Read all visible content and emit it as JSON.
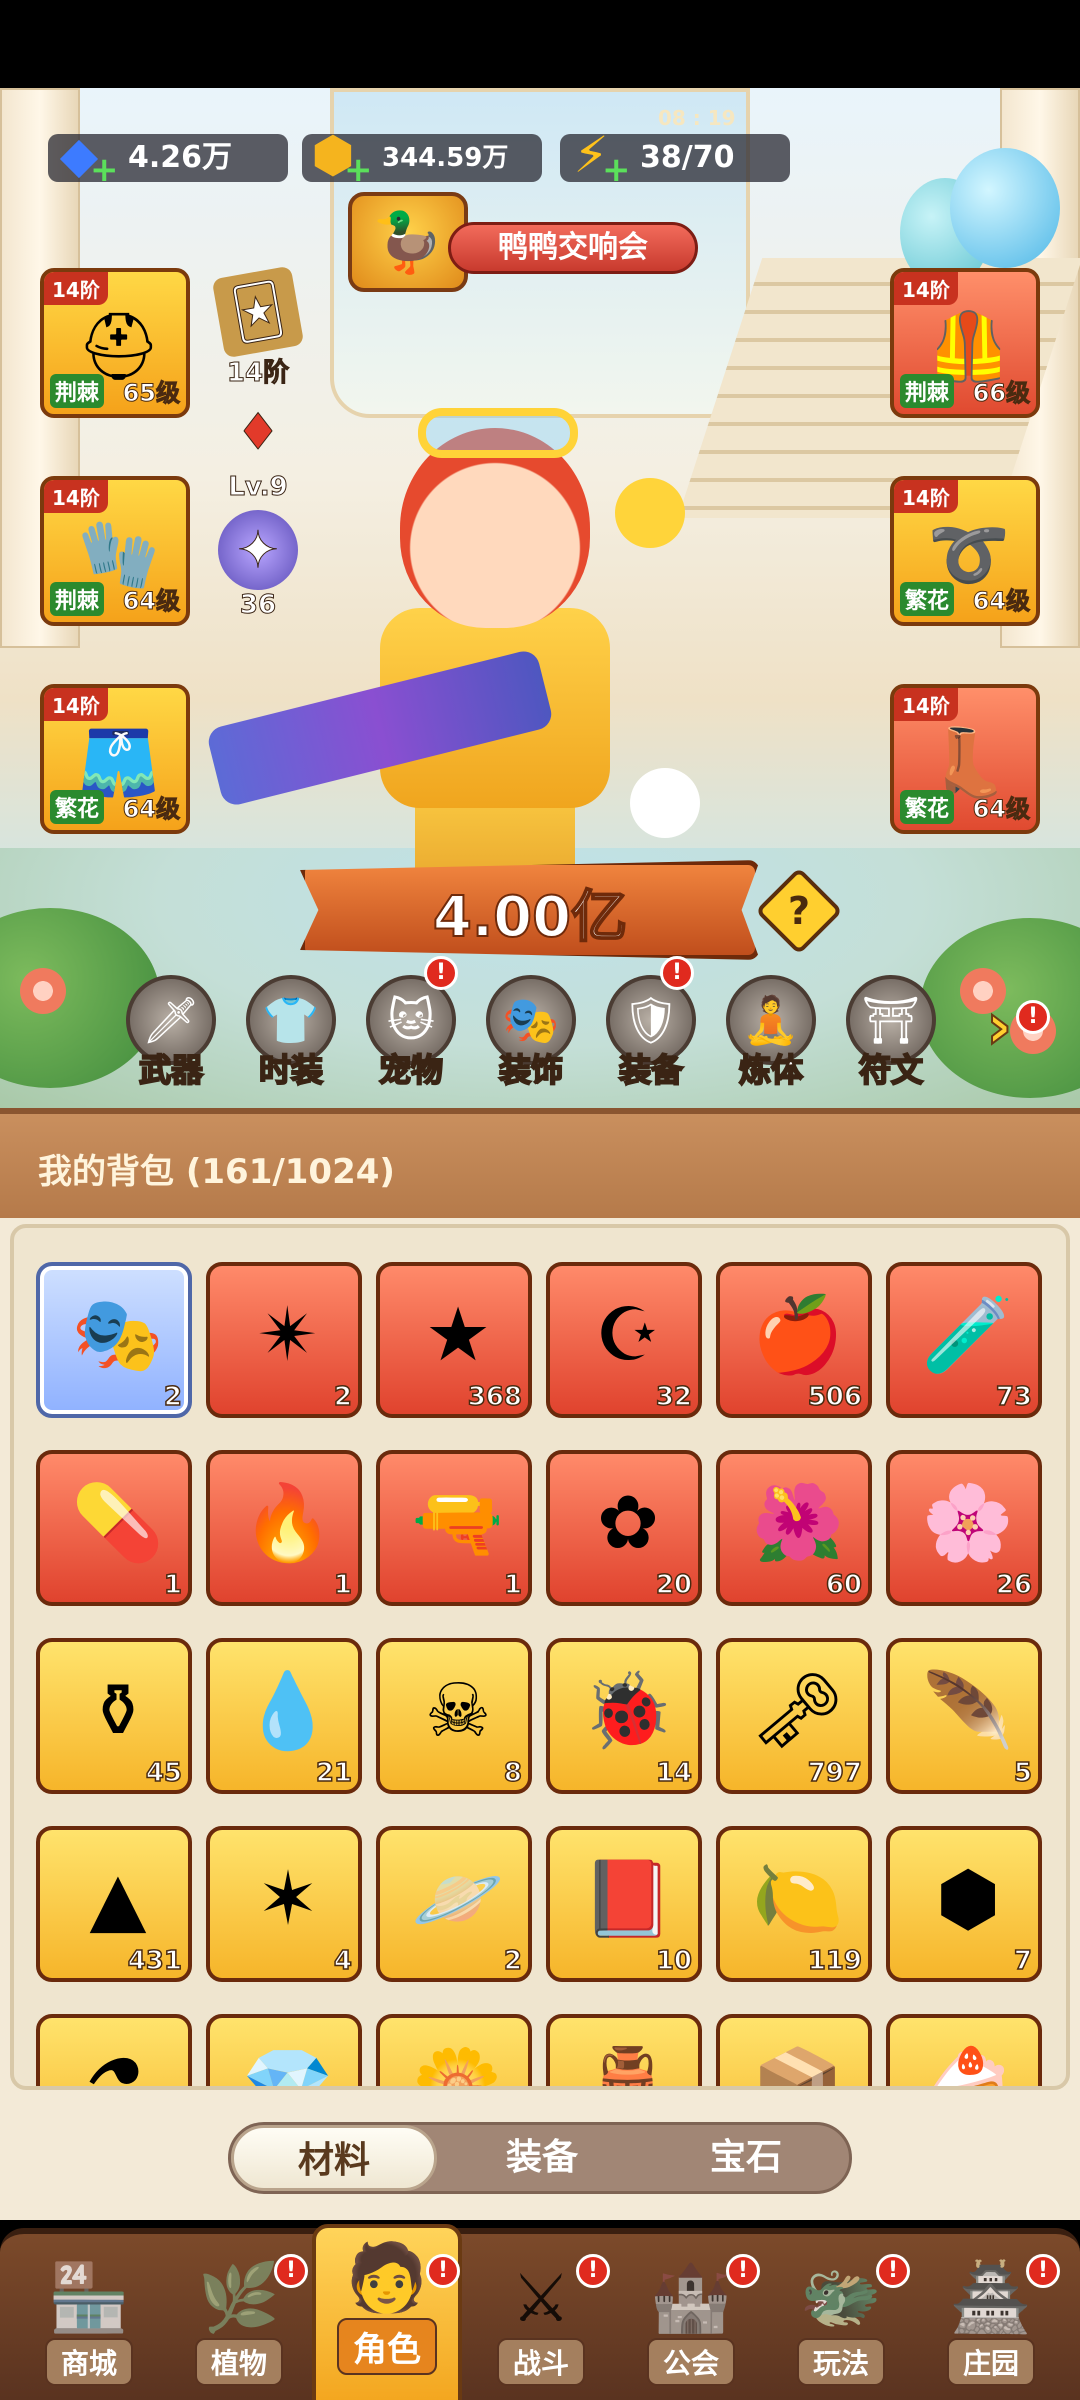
{
  "resources": {
    "gems": {
      "icon": "diamond-icon",
      "value": "4.26万"
    },
    "coins": {
      "icon": "coin-icon",
      "value": "344.59万"
    },
    "energy": {
      "icon": "lightning-icon",
      "value": "38/70",
      "timer": "08 : 19"
    }
  },
  "event": {
    "label": "鸭鸭交响会",
    "icon": "duck-cellist-icon"
  },
  "equipment_left": [
    {
      "tier": "14阶",
      "set": "荆棘",
      "level": "65级",
      "icon": "helmet-icon"
    },
    {
      "tier": "14阶",
      "set": "荆棘",
      "level": "64级",
      "icon": "glove-icon"
    },
    {
      "tier": "14阶",
      "set": "繁花",
      "level": "64级",
      "icon": "shorts-icon"
    }
  ],
  "equipment_right": [
    {
      "tier": "14阶",
      "set": "荆棘",
      "level": "66级",
      "icon": "vest-icon"
    },
    {
      "tier": "14阶",
      "set": "繁花",
      "level": "64级",
      "icon": "belt-icon"
    },
    {
      "tier": "14阶",
      "set": "繁花",
      "level": "64级",
      "icon": "boots-icon"
    }
  ],
  "side_items": [
    {
      "label": "14阶",
      "icon": "card-icon"
    },
    {
      "label": "Lv.9",
      "icon": "red-gem-icon"
    },
    {
      "label": "36",
      "icon": "star-orb-icon"
    }
  ],
  "power": {
    "value": "4.00亿",
    "help": "?"
  },
  "feature_nav": [
    {
      "label": "武器",
      "icon": "weapon-icon",
      "badge": false
    },
    {
      "label": "时装",
      "icon": "outfit-icon",
      "badge": false
    },
    {
      "label": "宠物",
      "icon": "pet-icon",
      "badge": true
    },
    {
      "label": "装饰",
      "icon": "mask-icon",
      "badge": false
    },
    {
      "label": "装备",
      "icon": "equipment-icon",
      "badge": true
    },
    {
      "label": "炼体",
      "icon": "body-icon",
      "badge": false
    },
    {
      "label": "符文",
      "icon": "rune-icon",
      "badge": false
    }
  ],
  "feature_more": {
    "icon": "chevron-right-icon",
    "badge": "!"
  },
  "backpack": {
    "title": "我的背包",
    "capacity": "(161/1024)",
    "items": [
      {
        "icon": "mask-icon",
        "count": "2",
        "rarity": "blue"
      },
      {
        "icon": "shuriken-icon",
        "count": "2",
        "rarity": "red"
      },
      {
        "icon": "blue-star-icon",
        "count": "368",
        "rarity": "red"
      },
      {
        "icon": "moon-star-icon",
        "count": "32",
        "rarity": "red"
      },
      {
        "icon": "apple-potion-icon",
        "count": "506",
        "rarity": "red"
      },
      {
        "icon": "green-tube-icon",
        "count": "73",
        "rarity": "red"
      },
      {
        "icon": "green-pill-icon",
        "count": "1",
        "rarity": "red"
      },
      {
        "icon": "red-flame-orb-icon",
        "count": "1",
        "rarity": "red"
      },
      {
        "icon": "blaster-icon",
        "count": "1",
        "rarity": "red"
      },
      {
        "icon": "pink-knot-icon",
        "count": "20",
        "rarity": "red"
      },
      {
        "icon": "plant-fire-icon",
        "count": "60",
        "rarity": "red"
      },
      {
        "icon": "plant-fire-2-icon",
        "count": "26",
        "rarity": "red"
      },
      {
        "icon": "gold-potion-icon",
        "count": "45",
        "rarity": "gold"
      },
      {
        "icon": "water-drop-icon",
        "count": "21",
        "rarity": "gold"
      },
      {
        "icon": "skull-scroll-icon",
        "count": "8",
        "rarity": "gold"
      },
      {
        "icon": "firefly-icon",
        "count": "14",
        "rarity": "gold"
      },
      {
        "icon": "key-icon",
        "count": "797",
        "rarity": "gold"
      },
      {
        "icon": "fire-feather-icon",
        "count": "5",
        "rarity": "gold"
      },
      {
        "icon": "fire-prism-icon",
        "count": "431",
        "rarity": "gold"
      },
      {
        "icon": "purple-star-icon",
        "count": "4",
        "rarity": "gold"
      },
      {
        "icon": "orbit-orb-icon",
        "count": "2",
        "rarity": "gold"
      },
      {
        "icon": "spell-book-icon",
        "count": "10",
        "rarity": "gold"
      },
      {
        "icon": "lemon-sprout-icon",
        "count": "119",
        "rarity": "gold"
      },
      {
        "icon": "dark-rune-icon",
        "count": "7",
        "rarity": "gold"
      }
    ],
    "partial_row": [
      {
        "icon": "potion-icon",
        "rarity": "gold"
      },
      {
        "icon": "crystal-icon",
        "rarity": "gold"
      },
      {
        "icon": "flower-icon",
        "rarity": "gold"
      },
      {
        "icon": "pot-icon",
        "rarity": "gold"
      },
      {
        "icon": "green-box-icon",
        "rarity": "gold"
      },
      {
        "icon": "cake-icon",
        "rarity": "gold"
      }
    ]
  },
  "tabs": [
    {
      "label": "材料",
      "active": true
    },
    {
      "label": "装备",
      "active": false
    },
    {
      "label": "宝石",
      "active": false
    }
  ],
  "bottom_nav": [
    {
      "label": "商城",
      "icon": "shop-icon",
      "badge": false,
      "active": false
    },
    {
      "label": "植物",
      "icon": "plant-icon",
      "badge": true,
      "active": false
    },
    {
      "label": "角色",
      "icon": "character-icon",
      "badge": true,
      "active": true
    },
    {
      "label": "战斗",
      "icon": "battle-icon",
      "badge": true,
      "active": false
    },
    {
      "label": "公会",
      "icon": "guild-icon",
      "badge": true,
      "active": false
    },
    {
      "label": "玩法",
      "icon": "gameplay-icon",
      "badge": true,
      "active": false
    },
    {
      "label": "庄园",
      "icon": "manor-icon",
      "badge": true,
      "active": false
    }
  ],
  "badge_text": "!",
  "colors": {
    "badge": "#e02a1e",
    "gold_cell": "#f6b52a",
    "red_cell": "#e0432e",
    "header_brown": "#b57a4a"
  }
}
